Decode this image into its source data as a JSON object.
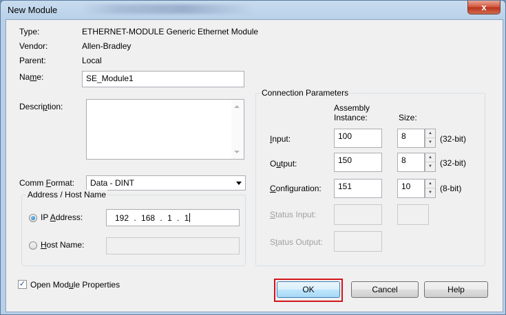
{
  "window": {
    "title": "New Module",
    "close_glyph": "x"
  },
  "info": {
    "type_label": "Type:",
    "type_value": "ETHERNET-MODULE Generic Ethernet Module",
    "vendor_label": "Vendor:",
    "vendor_value": "Allen-Bradley",
    "parent_label": "Parent:",
    "parent_value": "Local"
  },
  "name": {
    "label_pre": "Na",
    "label_key": "m",
    "label_post": "e:",
    "value": "SE_Module1"
  },
  "description": {
    "label_pre": "Descri",
    "label_key": "p",
    "label_post": "tion:",
    "value": ""
  },
  "comm_format": {
    "label_pre": "Comm ",
    "label_key": "F",
    "label_post": "ormat:",
    "value": "Data - DINT"
  },
  "address": {
    "group_title": "Address / Host Name",
    "ip_label_pre": "IP ",
    "ip_label_key": "A",
    "ip_label_post": "ddress:",
    "ip_octets": [
      "192",
      "168",
      "1",
      "1"
    ],
    "ip_dot": ".",
    "ip_selected": true,
    "host_label_key": "H",
    "host_label_post": "ost Name:",
    "host_value": ""
  },
  "connection": {
    "group_title": "Connection Parameters",
    "assembly_header_1": "Assembly",
    "assembly_header_2": "Instance:",
    "size_header": "Size:",
    "rows": [
      {
        "label_key": "I",
        "label_post": "nput:",
        "assembly": "100",
        "size": "8",
        "unit": "(32-bit)"
      },
      {
        "label_pre": "O",
        "label_key": "u",
        "label_post": "tput:",
        "assembly": "150",
        "size": "8",
        "unit": "(32-bit)"
      },
      {
        "label_key": "C",
        "label_post": "onfiguration:",
        "assembly": "151",
        "size": "10",
        "unit": "(8-bit)"
      }
    ],
    "status_input": {
      "label_key": "S",
      "label_post": "tatus Input:"
    },
    "status_output": {
      "label_pre": "S",
      "label_key": "t",
      "label_post": "atus Output:"
    }
  },
  "footer": {
    "open_props_pre": "Open Mod",
    "open_props_key": "u",
    "open_props_post": "le Properties",
    "open_props_checked": true,
    "ok": "OK",
    "cancel": "Cancel",
    "help": "Help"
  },
  "colors": {
    "highlight": "#d2141a",
    "titlebar": "#b7cfe8",
    "client": "#f0f0f0"
  }
}
